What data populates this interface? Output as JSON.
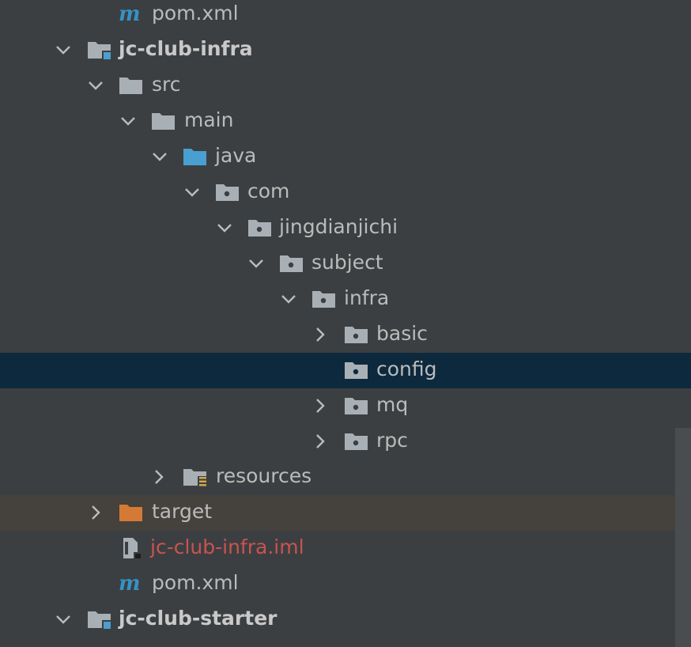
{
  "tree": {
    "items": [
      {
        "label": "pom.xml",
        "icon": "maven-m-icon"
      },
      {
        "label": "jc-club-infra",
        "icon": "module-folder-icon",
        "expanded": true
      },
      {
        "label": "src",
        "icon": "folder-icon",
        "expanded": true
      },
      {
        "label": "main",
        "icon": "folder-icon",
        "expanded": true
      },
      {
        "label": "java",
        "icon": "source-root-folder-icon",
        "expanded": true
      },
      {
        "label": "com",
        "icon": "package-icon",
        "expanded": true
      },
      {
        "label": "jingdianjichi",
        "icon": "package-icon",
        "expanded": true
      },
      {
        "label": "subject",
        "icon": "package-icon",
        "expanded": true
      },
      {
        "label": "infra",
        "icon": "package-icon",
        "expanded": true
      },
      {
        "label": "basic",
        "icon": "package-icon",
        "expanded": false
      },
      {
        "label": "config",
        "icon": "package-icon",
        "selected": true
      },
      {
        "label": "mq",
        "icon": "package-icon",
        "expanded": false
      },
      {
        "label": "rpc",
        "icon": "package-icon",
        "expanded": false
      },
      {
        "label": "resources",
        "icon": "resources-folder-icon",
        "expanded": false
      },
      {
        "label": "target",
        "icon": "excluded-folder-icon",
        "expanded": false
      },
      {
        "label": "jc-club-infra.iml",
        "icon": "iml-file-icon"
      },
      {
        "label": "pom.xml",
        "icon": "maven-m-icon"
      },
      {
        "label": "jc-club-starter",
        "icon": "module-folder-icon",
        "expanded": true
      }
    ]
  },
  "colors": {
    "background": "#3c3f41",
    "selected_row": "#0d293e",
    "excluded_row": "#45413c",
    "text": "#bbbbbb",
    "iml_text": "#c75450",
    "folder": "#a9b0b5",
    "source_folder": "#4a9fd1",
    "excluded_folder": "#d57a36",
    "maven_icon": "#3592c4"
  }
}
